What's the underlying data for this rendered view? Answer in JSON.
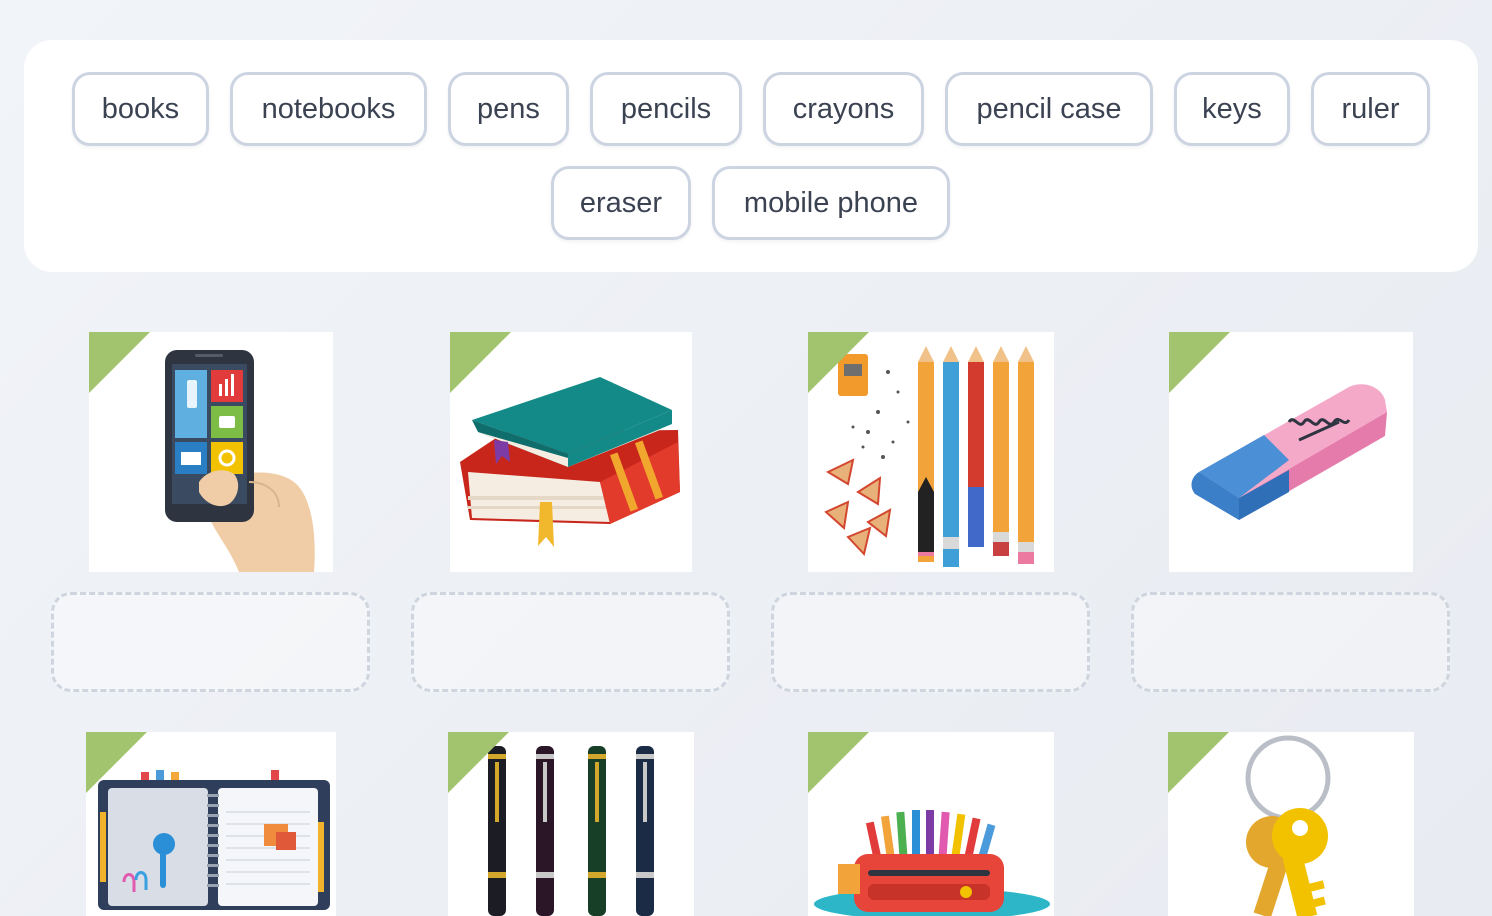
{
  "word_bank": {
    "words": [
      "books",
      "notebooks",
      "pens",
      "pencils",
      "crayons",
      "pencil case",
      "keys",
      "ruler",
      "eraser",
      "mobile phone"
    ]
  },
  "picture_cards": [
    {
      "icon": "mobile-phone-icon"
    },
    {
      "icon": "books-icon"
    },
    {
      "icon": "pencils-icon"
    },
    {
      "icon": "eraser-icon"
    },
    {
      "icon": "notebooks-icon"
    },
    {
      "icon": "pens-icon"
    },
    {
      "icon": "pencil-case-icon"
    },
    {
      "icon": "keys-icon"
    }
  ],
  "colors": {
    "corner_marker": "#a2c46e",
    "chip_border": "#cdd4e1",
    "drop_border": "#cfd5df"
  }
}
